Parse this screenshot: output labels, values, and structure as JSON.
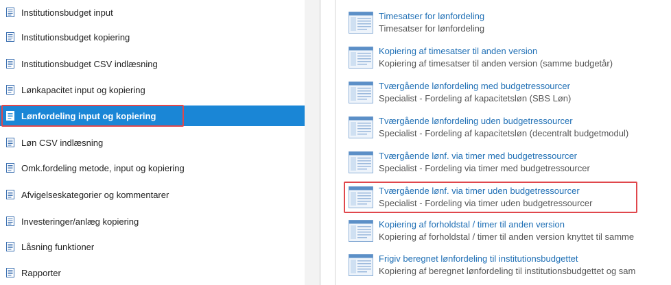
{
  "nav": {
    "items": [
      {
        "label": "Institutionsbudget input"
      },
      {
        "label": "Institutionsbudget kopiering"
      },
      {
        "label": "Institutionsbudget CSV indlæsning"
      },
      {
        "label": "Lønkapacitet input og kopiering"
      },
      {
        "label": "Lønfordeling input og kopiering",
        "active": true
      },
      {
        "label": "Løn CSV indlæsning"
      },
      {
        "label": "Omk.fordeling metode, input og kopiering"
      },
      {
        "label": "Afvigelseskategorier og kommentarer"
      },
      {
        "label": "Investeringer/anlæg kopiering"
      },
      {
        "label": "Låsning funktioner"
      },
      {
        "label": "Rapporter"
      }
    ]
  },
  "reports": {
    "items": [
      {
        "title": "Timesatser for lønfordeling",
        "desc": "Timesatser for lønfordeling"
      },
      {
        "title": "Kopiering af timesatser til anden version",
        "desc": "Kopiering af timesatser til anden version (samme budgetår)"
      },
      {
        "title": "Tværgående lønfordeling med budgetressourcer",
        "desc": "Specialist - Fordeling af kapacitetsløn (SBS Løn)"
      },
      {
        "title": "Tværgående lønfordeling uden budgetressourcer",
        "desc": "Specialist - Fordeling af kapacitetsløn (decentralt budgetmodul)"
      },
      {
        "title": "Tværgående lønf. via timer med budgetressourcer",
        "desc": "Specialist - Fordeling via timer med budgetressourcer"
      },
      {
        "title": "Tværgående lønf. via timer uden budgetressourcer",
        "desc": "Specialist - Fordeling via timer uden budgetressourcer"
      },
      {
        "title": "Kopiering af forholdstal / timer til anden version",
        "desc": "Kopiering af forholdstal / timer til anden version knyttet til samme"
      },
      {
        "title": "Frigiv beregnet lønfordeling til institutionsbudgettet",
        "desc": "Kopiering af beregnet lønfordeling til institutionsbudgettet og sam"
      }
    ]
  },
  "icons": {
    "nav": "document-icon",
    "report": "report-document-icon"
  },
  "colors": {
    "accent": "#1a86d6",
    "link": "#1f6fb5",
    "highlight": "#e0474c"
  }
}
